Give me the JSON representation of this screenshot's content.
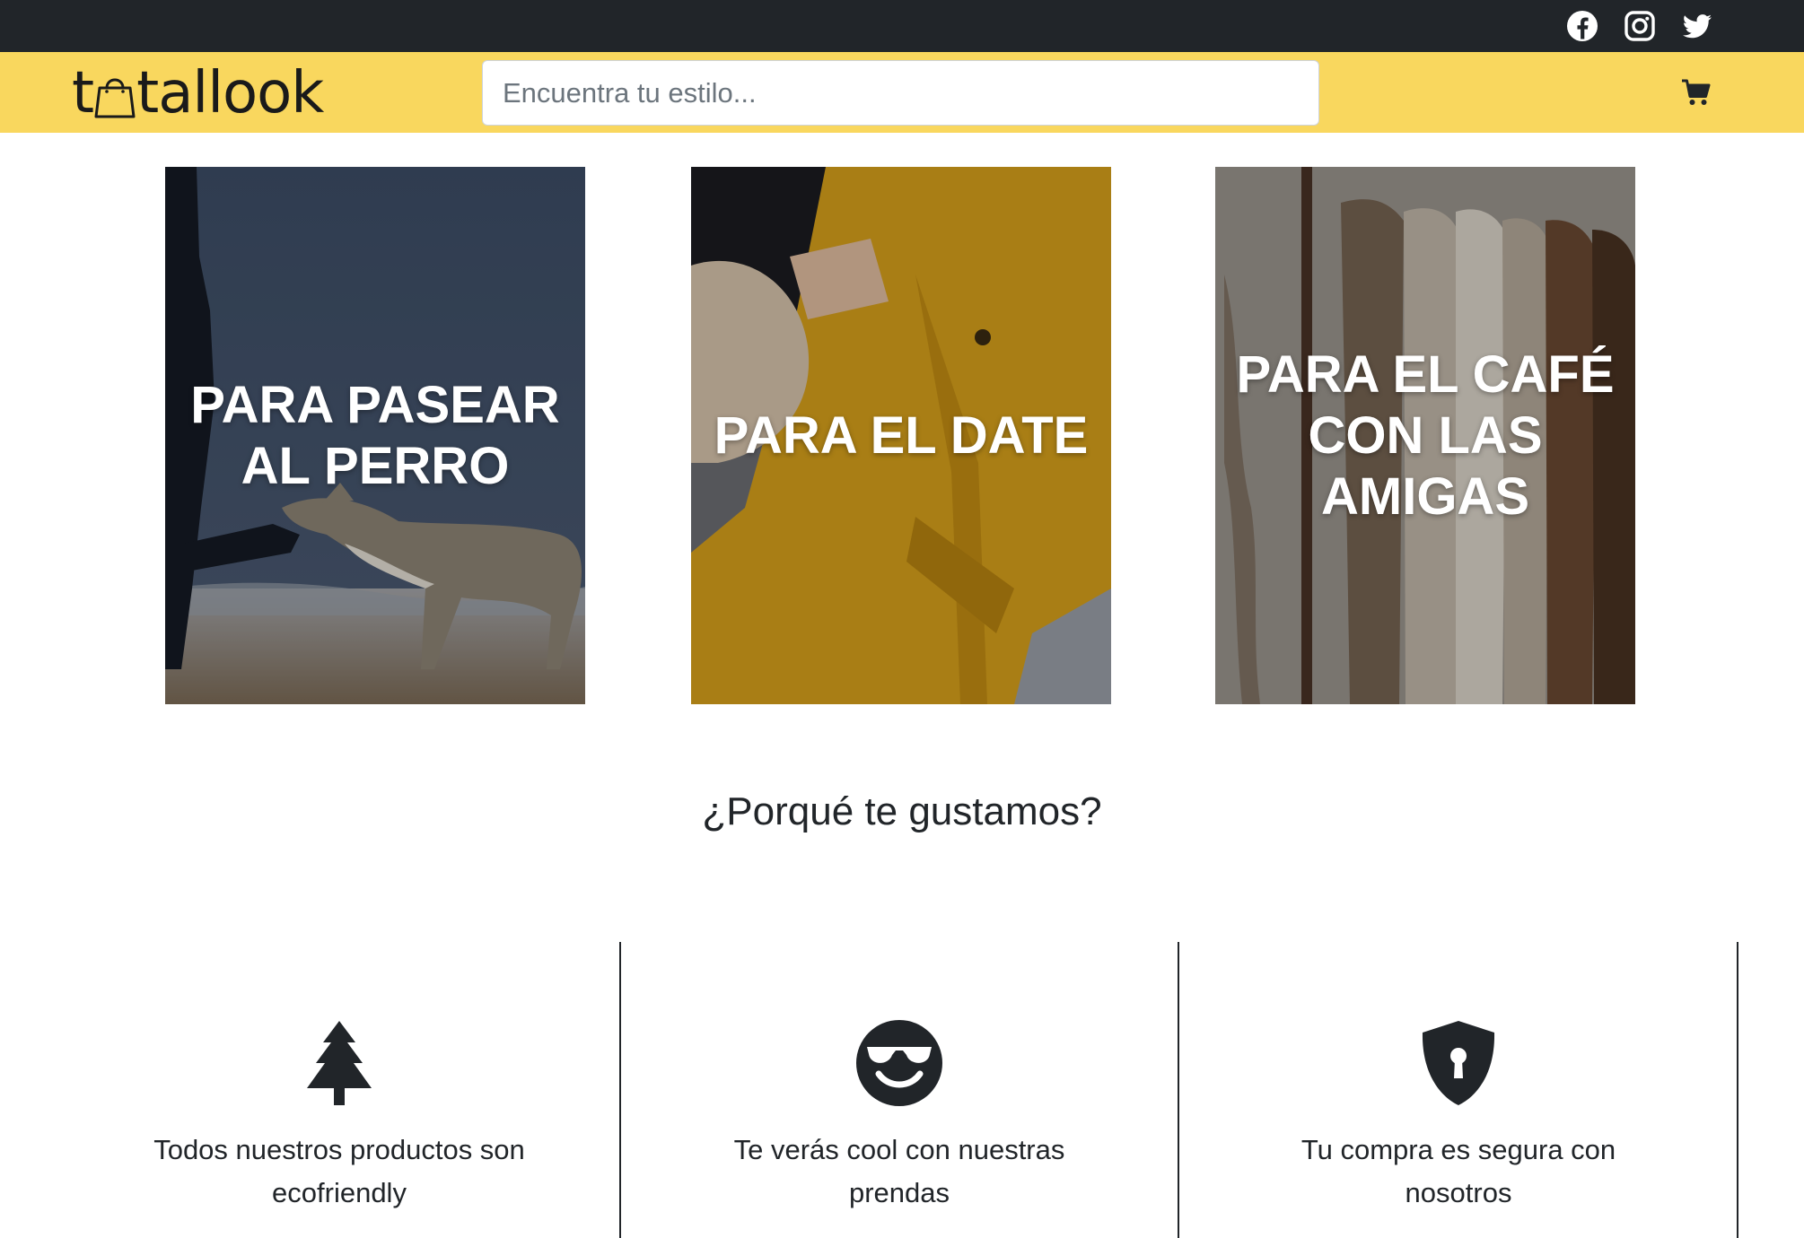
{
  "header": {
    "social_icons": [
      "facebook-icon",
      "instagram-icon",
      "twitter-icon"
    ],
    "brand": {
      "logo_prefix": "t",
      "logo_suffix": "tallook",
      "logo_icon": "shopping-bag-icon"
    },
    "search": {
      "placeholder": "Encuentra tu estilo..."
    },
    "cart_icon": "cart-icon"
  },
  "categories": [
    {
      "title": "PARA PASEAR\nAL PERRO"
    },
    {
      "title": "PARA EL DATE"
    },
    {
      "title": "PARA EL CAFÉ\nCON LAS AMIGAS"
    }
  ],
  "why_section": {
    "title": "¿Porqué te gustamos?",
    "features": [
      {
        "icon": "tree-icon",
        "text": "Todos nuestros productos son ecofriendly"
      },
      {
        "icon": "smile-sunglasses-icon",
        "text": "Te verás cool con nuestras prendas"
      },
      {
        "icon": "shield-lock-icon",
        "text": "Tu compra es segura con nosotros"
      }
    ]
  },
  "colors": {
    "topbar": "#212529",
    "navbar": "#f9d75e",
    "text": "#212529",
    "mustard": "#d9a21c"
  }
}
